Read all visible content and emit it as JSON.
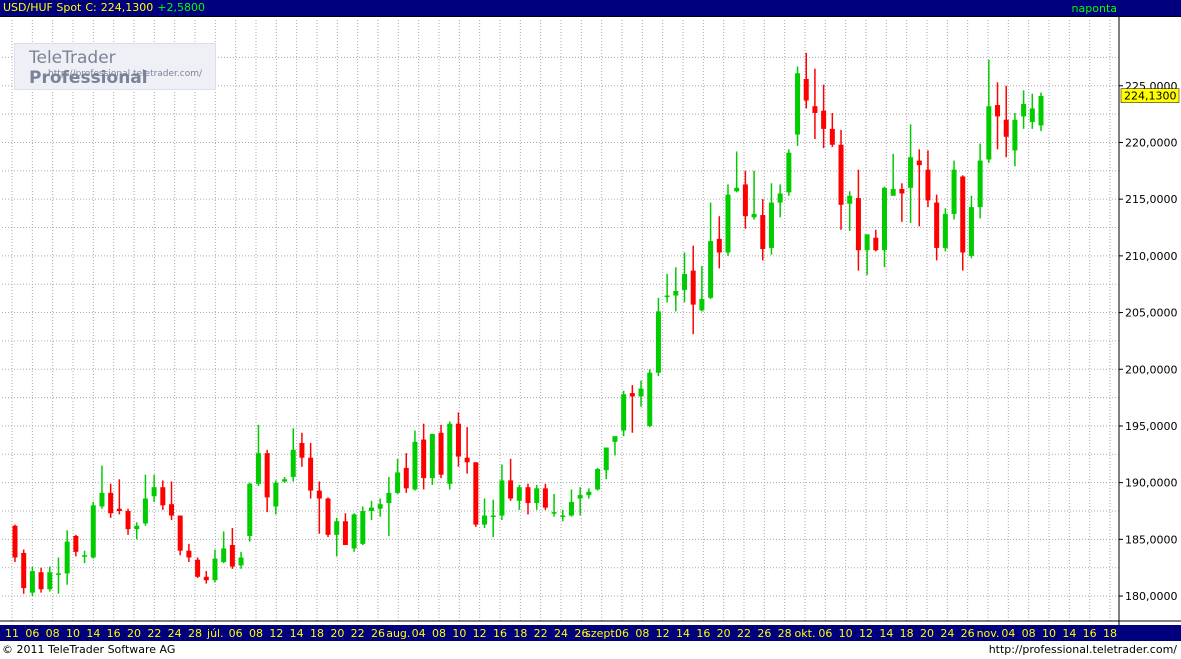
{
  "header": {
    "symbol": "USD/HUF Spot",
    "close_label": "C:",
    "close_value": "224,1300",
    "change": "+2,5800",
    "period": "naponta"
  },
  "watermark": {
    "brand": "TeleTrader",
    "brand_bold": "Professional",
    "url": "http://professional.teletrader.com/"
  },
  "footer": {
    "copyright": "© 2011  TeleTrader Software AG",
    "url": "http://professional.teletrader.com/"
  },
  "chart_data": {
    "type": "candlestick",
    "x_tick_labels": [
      "11",
      "06",
      "08",
      "10",
      "14",
      "16",
      "20",
      "22",
      "24",
      "28",
      "júl.",
      "06",
      "08",
      "12",
      "14",
      "18",
      "20",
      "22",
      "26",
      "aug.",
      "04",
      "08",
      "10",
      "12",
      "16",
      "18",
      "22",
      "24",
      "26",
      "szept.",
      "06",
      "08",
      "12",
      "14",
      "16",
      "20",
      "22",
      "26",
      "28",
      "okt.",
      "06",
      "10",
      "12",
      "14",
      "18",
      "20",
      "24",
      "26",
      "nov.",
      "04",
      "08",
      "10",
      "14",
      "16",
      "18"
    ],
    "y_tick_labels": [
      "180,0000",
      "185,0000",
      "190,0000",
      "195,0000",
      "200,0000",
      "205,0000",
      "210,0000",
      "215,0000",
      "220,0000",
      "225,0000"
    ],
    "ylim": [
      177.8,
      230.8
    ],
    "last_value_label": "224,1300",
    "colors": {
      "up": "#00cc00",
      "down": "#ff0000",
      "axis_bg": "#00007e",
      "axis_text": "#ffff00",
      "grid": "#aaaaaa"
    },
    "candles": [
      {
        "o": 186.2,
        "h": 186.3,
        "l": 183.0,
        "c": 183.4
      },
      {
        "o": 183.8,
        "h": 184.1,
        "l": 180.2,
        "c": 180.7
      },
      {
        "o": 180.3,
        "h": 182.6,
        "l": 180.0,
        "c": 182.2
      },
      {
        "o": 182.1,
        "h": 182.5,
        "l": 180.3,
        "c": 180.6
      },
      {
        "o": 180.6,
        "h": 182.6,
        "l": 180.4,
        "c": 182.1
      },
      {
        "o": 182.0,
        "h": 183.4,
        "l": 180.2,
        "c": 182.0
      },
      {
        "o": 182.0,
        "h": 185.8,
        "l": 181.0,
        "c": 184.8
      },
      {
        "o": 185.3,
        "h": 185.4,
        "l": 183.5,
        "c": 183.9
      },
      {
        "o": 183.6,
        "h": 184.0,
        "l": 182.9,
        "c": 183.6
      },
      {
        "o": 183.4,
        "h": 188.3,
        "l": 183.3,
        "c": 188.0
      },
      {
        "o": 187.9,
        "h": 191.5,
        "l": 187.7,
        "c": 189.1
      },
      {
        "o": 189.1,
        "h": 189.9,
        "l": 186.9,
        "c": 187.3
      },
      {
        "o": 187.7,
        "h": 190.3,
        "l": 187.2,
        "c": 187.5
      },
      {
        "o": 187.5,
        "h": 187.7,
        "l": 185.4,
        "c": 185.9
      },
      {
        "o": 185.9,
        "h": 186.5,
        "l": 185.0,
        "c": 186.2
      },
      {
        "o": 186.4,
        "h": 190.7,
        "l": 186.2,
        "c": 188.6
      },
      {
        "o": 188.8,
        "h": 190.7,
        "l": 188.3,
        "c": 189.6
      },
      {
        "o": 189.6,
        "h": 190.2,
        "l": 187.6,
        "c": 188.0
      },
      {
        "o": 188.1,
        "h": 190.1,
        "l": 186.7,
        "c": 187.1
      },
      {
        "o": 187.1,
        "h": 187.1,
        "l": 183.6,
        "c": 184.0
      },
      {
        "o": 184.0,
        "h": 184.6,
        "l": 183.0,
        "c": 183.4
      },
      {
        "o": 183.2,
        "h": 183.4,
        "l": 181.6,
        "c": 181.7
      },
      {
        "o": 181.7,
        "h": 182.2,
        "l": 181.1,
        "c": 181.4
      },
      {
        "o": 181.4,
        "h": 184.1,
        "l": 181.2,
        "c": 183.3
      },
      {
        "o": 183.0,
        "h": 185.7,
        "l": 182.9,
        "c": 184.2
      },
      {
        "o": 184.5,
        "h": 186.0,
        "l": 182.4,
        "c": 182.6
      },
      {
        "o": 182.7,
        "h": 183.9,
        "l": 182.4,
        "c": 183.4
      },
      {
        "o": 185.3,
        "h": 190.0,
        "l": 184.8,
        "c": 189.9
      },
      {
        "o": 189.9,
        "h": 195.1,
        "l": 189.7,
        "c": 192.6
      },
      {
        "o": 192.6,
        "h": 192.9,
        "l": 187.4,
        "c": 188.7
      },
      {
        "o": 187.9,
        "h": 190.2,
        "l": 187.2,
        "c": 190.0
      },
      {
        "o": 190.1,
        "h": 190.5,
        "l": 190.0,
        "c": 190.3
      },
      {
        "o": 190.5,
        "h": 194.8,
        "l": 190.1,
        "c": 192.9
      },
      {
        "o": 193.5,
        "h": 194.4,
        "l": 191.4,
        "c": 192.2
      },
      {
        "o": 192.2,
        "h": 193.5,
        "l": 188.6,
        "c": 189.3
      },
      {
        "o": 189.3,
        "h": 190.1,
        "l": 185.5,
        "c": 188.6
      },
      {
        "o": 188.6,
        "h": 188.7,
        "l": 185.2,
        "c": 185.4
      },
      {
        "o": 185.4,
        "h": 186.9,
        "l": 183.5,
        "c": 186.6
      },
      {
        "o": 186.6,
        "h": 187.3,
        "l": 184.7,
        "c": 184.5
      },
      {
        "o": 184.2,
        "h": 187.3,
        "l": 183.9,
        "c": 187.2
      },
      {
        "o": 184.6,
        "h": 187.9,
        "l": 184.5,
        "c": 187.5
      },
      {
        "o": 187.5,
        "h": 188.4,
        "l": 186.7,
        "c": 187.8
      },
      {
        "o": 187.7,
        "h": 188.6,
        "l": 187.0,
        "c": 188.1
      },
      {
        "o": 188.2,
        "h": 190.5,
        "l": 185.3,
        "c": 189.1
      },
      {
        "o": 189.1,
        "h": 192.1,
        "l": 189.0,
        "c": 190.9
      },
      {
        "o": 191.3,
        "h": 192.6,
        "l": 189.1,
        "c": 189.5
      },
      {
        "o": 189.4,
        "h": 194.6,
        "l": 189.3,
        "c": 193.6
      },
      {
        "o": 193.8,
        "h": 195.2,
        "l": 189.4,
        "c": 190.4
      },
      {
        "o": 190.4,
        "h": 194.3,
        "l": 189.8,
        "c": 194.3
      },
      {
        "o": 194.4,
        "h": 195.1,
        "l": 190.4,
        "c": 190.7
      },
      {
        "o": 189.9,
        "h": 195.4,
        "l": 189.4,
        "c": 195.2
      },
      {
        "o": 195.2,
        "h": 196.2,
        "l": 191.4,
        "c": 192.3
      },
      {
        "o": 192.2,
        "h": 194.9,
        "l": 190.8,
        "c": 191.8
      },
      {
        "o": 191.8,
        "h": 191.8,
        "l": 186.1,
        "c": 186.3
      },
      {
        "o": 186.3,
        "h": 188.6,
        "l": 186.0,
        "c": 187.1
      },
      {
        "o": 187.1,
        "h": 188.5,
        "l": 185.2,
        "c": 187.1
      },
      {
        "o": 187.1,
        "h": 191.6,
        "l": 186.7,
        "c": 190.2
      },
      {
        "o": 190.2,
        "h": 192.1,
        "l": 188.4,
        "c": 188.6
      },
      {
        "o": 188.4,
        "h": 189.8,
        "l": 187.6,
        "c": 189.6
      },
      {
        "o": 189.6,
        "h": 189.9,
        "l": 187.2,
        "c": 188.2
      },
      {
        "o": 188.2,
        "h": 189.8,
        "l": 187.6,
        "c": 189.5
      },
      {
        "o": 189.5,
        "h": 189.9,
        "l": 187.6,
        "c": 187.8
      },
      {
        "o": 187.4,
        "h": 189.0,
        "l": 187.0,
        "c": 187.4
      },
      {
        "o": 187.1,
        "h": 187.6,
        "l": 186.6,
        "c": 187.1
      },
      {
        "o": 187.1,
        "h": 189.4,
        "l": 187.0,
        "c": 188.3
      },
      {
        "o": 188.6,
        "h": 189.6,
        "l": 187.1,
        "c": 188.9
      },
      {
        "o": 188.9,
        "h": 189.5,
        "l": 188.6,
        "c": 189.2
      },
      {
        "o": 189.4,
        "h": 191.3,
        "l": 189.3,
        "c": 191.2
      },
      {
        "o": 191.1,
        "h": 192.8,
        "l": 190.3,
        "c": 193.1
      },
      {
        "o": 193.6,
        "h": 194.0,
        "l": 192.4,
        "c": 194.1
      },
      {
        "o": 194.6,
        "h": 198.1,
        "l": 194.1,
        "c": 197.8
      },
      {
        "o": 197.9,
        "h": 198.6,
        "l": 194.4,
        "c": 197.6
      },
      {
        "o": 197.6,
        "h": 199.0,
        "l": 196.7,
        "c": 198.3
      },
      {
        "o": 195.0,
        "h": 200.0,
        "l": 194.9,
        "c": 199.7
      },
      {
        "o": 199.7,
        "h": 206.3,
        "l": 199.4,
        "c": 205.1
      },
      {
        "o": 206.5,
        "h": 208.4,
        "l": 205.9,
        "c": 206.5
      },
      {
        "o": 206.5,
        "h": 209.0,
        "l": 205.1,
        "c": 206.9
      },
      {
        "o": 207.0,
        "h": 210.3,
        "l": 205.9,
        "c": 208.4
      },
      {
        "o": 208.7,
        "h": 210.9,
        "l": 203.1,
        "c": 205.7
      },
      {
        "o": 205.2,
        "h": 209.1,
        "l": 205.1,
        "c": 206.2
      },
      {
        "o": 206.3,
        "h": 214.7,
        "l": 206.2,
        "c": 211.3
      },
      {
        "o": 211.5,
        "h": 213.5,
        "l": 208.9,
        "c": 210.3
      },
      {
        "o": 210.3,
        "h": 216.3,
        "l": 210.0,
        "c": 215.4
      },
      {
        "o": 215.7,
        "h": 219.2,
        "l": 215.6,
        "c": 216.0
      },
      {
        "o": 216.3,
        "h": 217.5,
        "l": 212.4,
        "c": 213.5
      },
      {
        "o": 213.4,
        "h": 217.5,
        "l": 213.2,
        "c": 213.7
      },
      {
        "o": 213.6,
        "h": 215.0,
        "l": 209.6,
        "c": 210.6
      },
      {
        "o": 210.7,
        "h": 216.4,
        "l": 210.1,
        "c": 214.7
      },
      {
        "o": 214.7,
        "h": 216.3,
        "l": 213.4,
        "c": 215.5
      },
      {
        "o": 215.6,
        "h": 219.4,
        "l": 215.3,
        "c": 219.1
      },
      {
        "o": 220.7,
        "h": 226.7,
        "l": 219.7,
        "c": 226.1
      },
      {
        "o": 225.6,
        "h": 227.9,
        "l": 223.0,
        "c": 223.7
      },
      {
        "o": 223.2,
        "h": 226.5,
        "l": 220.3,
        "c": 222.6
      },
      {
        "o": 222.8,
        "h": 225.1,
        "l": 219.5,
        "c": 221.2
      },
      {
        "o": 221.2,
        "h": 222.6,
        "l": 219.6,
        "c": 219.8
      },
      {
        "o": 219.8,
        "h": 221.1,
        "l": 212.3,
        "c": 214.5
      },
      {
        "o": 214.6,
        "h": 215.7,
        "l": 212.2,
        "c": 215.3
      },
      {
        "o": 215.1,
        "h": 217.6,
        "l": 208.7,
        "c": 210.5
      },
      {
        "o": 210.5,
        "h": 211.5,
        "l": 208.3,
        "c": 211.9
      },
      {
        "o": 211.6,
        "h": 212.3,
        "l": 210.4,
        "c": 210.5
      },
      {
        "o": 210.5,
        "h": 216.1,
        "l": 209.0,
        "c": 216.0
      },
      {
        "o": 215.3,
        "h": 219.0,
        "l": 215.3,
        "c": 215.9
      },
      {
        "o": 215.9,
        "h": 216.4,
        "l": 213.0,
        "c": 215.5
      },
      {
        "o": 216.0,
        "h": 221.6,
        "l": 212.9,
        "c": 218.7
      },
      {
        "o": 218.4,
        "h": 219.4,
        "l": 212.6,
        "c": 218.0
      },
      {
        "o": 217.6,
        "h": 219.3,
        "l": 214.3,
        "c": 214.9
      },
      {
        "o": 214.7,
        "h": 215.4,
        "l": 209.6,
        "c": 210.7
      },
      {
        "o": 210.7,
        "h": 214.2,
        "l": 210.4,
        "c": 213.7
      },
      {
        "o": 213.7,
        "h": 218.4,
        "l": 213.2,
        "c": 217.6
      },
      {
        "o": 217.0,
        "h": 217.1,
        "l": 208.7,
        "c": 210.3
      },
      {
        "o": 210.0,
        "h": 215.3,
        "l": 209.8,
        "c": 214.3
      },
      {
        "o": 214.3,
        "h": 219.9,
        "l": 213.3,
        "c": 218.4
      },
      {
        "o": 218.5,
        "h": 227.3,
        "l": 218.2,
        "c": 223.2
      },
      {
        "o": 223.3,
        "h": 225.3,
        "l": 219.4,
        "c": 222.3
      },
      {
        "o": 222.0,
        "h": 225.0,
        "l": 218.7,
        "c": 220.5
      },
      {
        "o": 219.3,
        "h": 222.6,
        "l": 217.9,
        "c": 222.0
      },
      {
        "o": 222.3,
        "h": 224.6,
        "l": 221.2,
        "c": 223.4
      },
      {
        "o": 221.8,
        "h": 224.3,
        "l": 221.2,
        "c": 223.0
      },
      {
        "o": 221.5,
        "h": 224.4,
        "l": 221.0,
        "c": 224.1
      }
    ]
  }
}
